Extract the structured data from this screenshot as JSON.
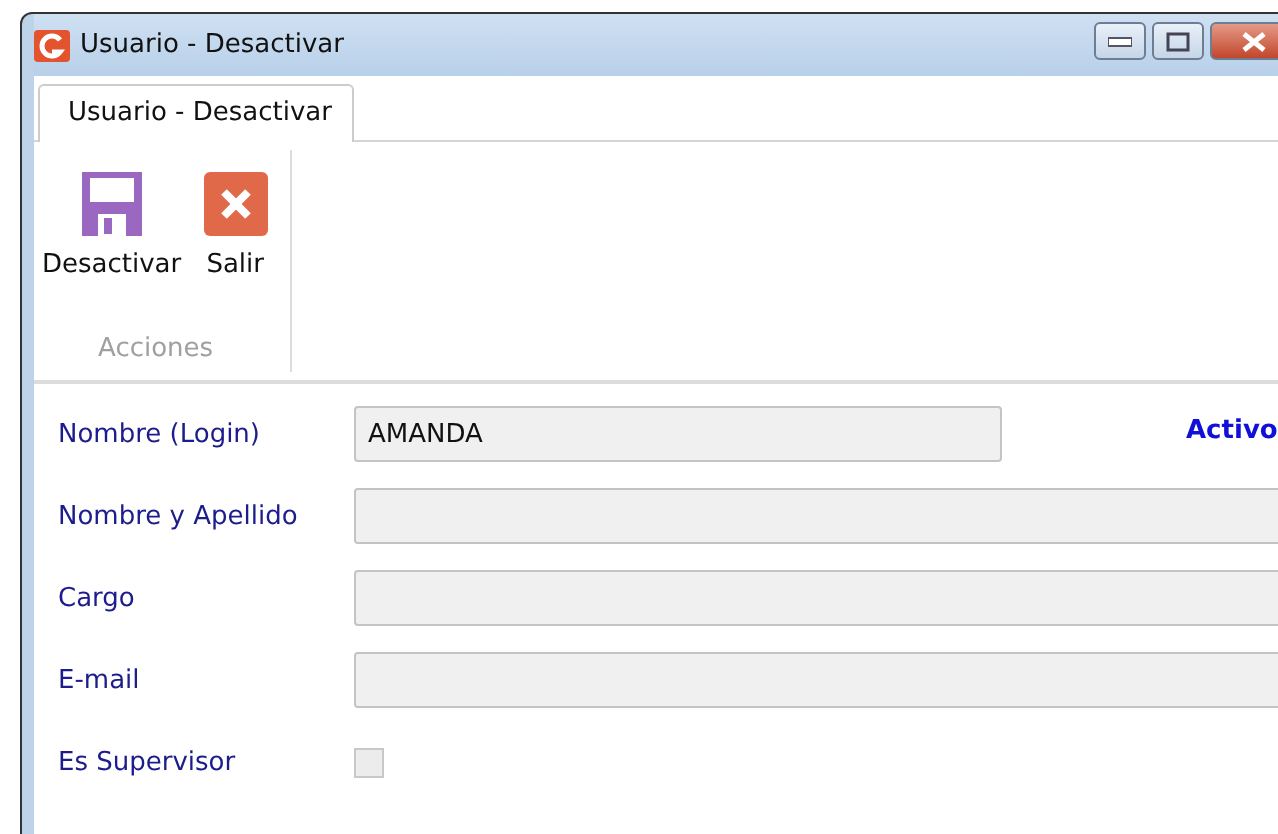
{
  "window": {
    "title": "Usuario - Desactivar"
  },
  "tabs": [
    {
      "label": "Usuario - Desactivar",
      "selected": true
    }
  ],
  "ribbon": {
    "group": "Acciones",
    "buttons": [
      {
        "label": "Desactivar",
        "kind": "save"
      },
      {
        "label": "Salir",
        "kind": "exit"
      }
    ]
  },
  "status": "Activo",
  "fields": [
    {
      "kind": "text",
      "label": "Nombre (Login)",
      "value": "AMANDA",
      "wide": false,
      "disabled": true
    },
    {
      "kind": "text",
      "label": "Nombre y Apellido",
      "wide": true,
      "disabled": true
    },
    {
      "kind": "text",
      "label": "Cargo",
      "wide": true,
      "disabled": true
    },
    {
      "kind": "text",
      "label": "E-mail",
      "wide": true,
      "disabled": true
    },
    {
      "kind": "checkbox",
      "label": "Es Supervisor",
      "checked": false,
      "disabled": true
    }
  ]
}
